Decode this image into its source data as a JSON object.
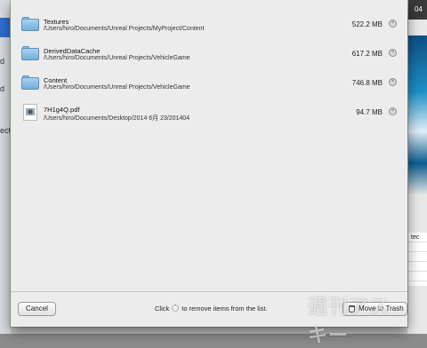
{
  "items": [
    {
      "name": "Textures",
      "path": "/Users/hiro/Documents/Unreal Projects/MyProject/Content",
      "size": "522.2 MB",
      "icon": "folder-icon"
    },
    {
      "name": "DerivedDataCache",
      "path": "/Users/hiro/Documents/Unreal Projects/VehicleGame",
      "size": "617.2 MB",
      "icon": "folder-icon"
    },
    {
      "name": "Content",
      "path": "/Users/hiro/Documents/Unreal Projects/VehicleGame",
      "size": "746.8 MB",
      "icon": "folder-icon"
    },
    {
      "name": "7H1g4Q.pdf",
      "path": "/Users/hiro/Documents/Desktop/2014 6月 23/201404",
      "size": "94.7 MB",
      "icon": "pdf-file-icon"
    }
  ],
  "footer": {
    "cancel_label": "Cancel",
    "hint_before": "Click",
    "hint_after": "to remove items from the list.",
    "move_to_trash_label": "Move to Trash"
  },
  "background": {
    "left_fragments": [
      "d",
      "d",
      "ect"
    ],
    "right_fragments": [
      "04",
      "tec"
    ]
  },
  "watermark": "週刊アスキー",
  "colors": {
    "sheet": "#ececec",
    "folder": "#74aedb"
  }
}
